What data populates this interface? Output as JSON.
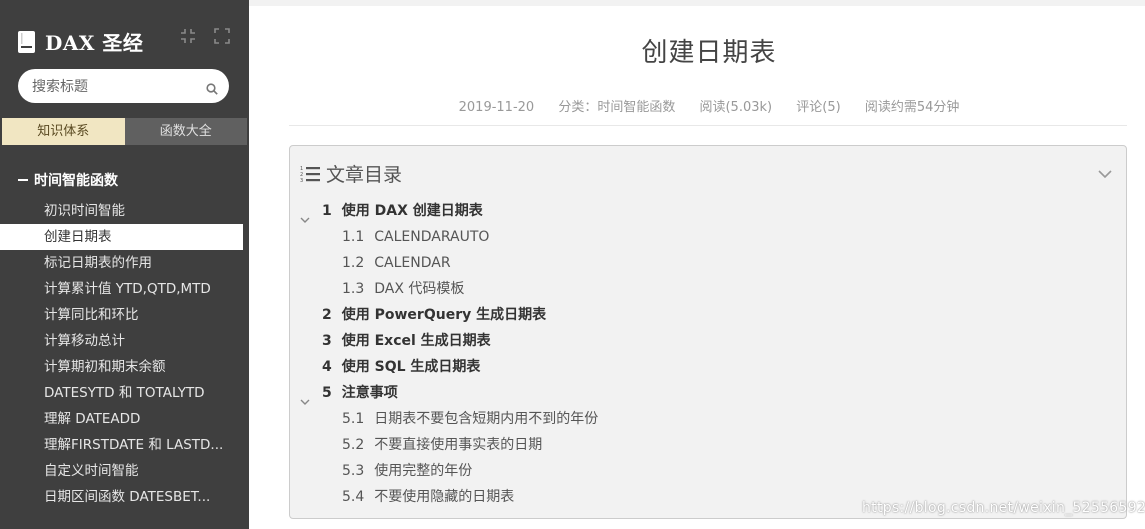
{
  "sidebar": {
    "brand_title": "DAX 圣经",
    "search_placeholder": "搜索标题",
    "tabs": [
      {
        "label": "知识体系"
      },
      {
        "label": "函数大全"
      }
    ],
    "section_title": "时间智能函数",
    "items": [
      {
        "label": "初识时间智能"
      },
      {
        "label": "创建日期表"
      },
      {
        "label": "标记日期表的作用"
      },
      {
        "label": "计算累计值 YTD,QTD,MTD"
      },
      {
        "label": "计算同比和环比"
      },
      {
        "label": "计算移动总计"
      },
      {
        "label": "计算期初和期末余额"
      },
      {
        "label": "DATESYTD 和 TOTALYTD"
      },
      {
        "label": "理解 DATEADD"
      },
      {
        "label": "理解FIRSTDATE 和 LASTD..."
      },
      {
        "label": "自定义时间智能"
      },
      {
        "label": "日期区间函数 DATESBET..."
      }
    ],
    "active_item": "创建日期表"
  },
  "article": {
    "title": "创建日期表",
    "date": "2019-11-20",
    "category": "分类：时间智能函数",
    "reads": "阅读(5.03k)",
    "comments": "评论(5)",
    "read_time": "阅读约需54分钟"
  },
  "toc": {
    "title": "文章目录",
    "items": [
      {
        "num": "1",
        "label": "使用 DAX 创建日期表",
        "level": 1,
        "expanded": true
      },
      {
        "num": "1.1",
        "label": "CALENDARAUTO",
        "level": 2
      },
      {
        "num": "1.2",
        "label": "CALENDAR",
        "level": 2
      },
      {
        "num": "1.3",
        "label": "DAX 代码模板",
        "level": 2
      },
      {
        "num": "2",
        "label": "使用 PowerQuery 生成日期表",
        "level": 1
      },
      {
        "num": "3",
        "label": "使用 Excel 生成日期表",
        "level": 1
      },
      {
        "num": "4",
        "label": "使用 SQL 生成日期表",
        "level": 1
      },
      {
        "num": "5",
        "label": "注意事项",
        "level": 1,
        "expanded": true
      },
      {
        "num": "5.1",
        "label": "日期表不要包含短期内用不到的年份",
        "level": 2
      },
      {
        "num": "5.2",
        "label": "不要直接使用事实表的日期",
        "level": 2
      },
      {
        "num": "5.3",
        "label": "使用完整的年份",
        "level": 2
      },
      {
        "num": "5.4",
        "label": "不要使用隐藏的日期表",
        "level": 2
      }
    ]
  },
  "watermark": "https://blog.csdn.net/weixin_52556592",
  "colors": {
    "sidebar_bg": "#3f3f3f",
    "tab_active_bg": "#f1e6c2",
    "toc_bg": "#f2f2f2"
  }
}
